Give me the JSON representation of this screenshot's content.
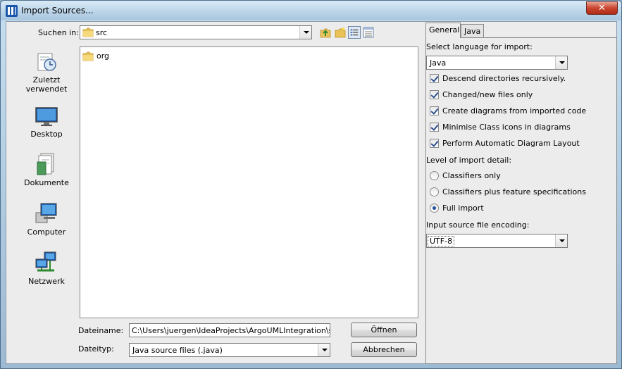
{
  "window": {
    "title": "Import Sources..."
  },
  "browser": {
    "look_in_label": "Suchen in:",
    "current_folder": "src",
    "places": [
      {
        "label_line1": "Zuletzt",
        "label_line2": "verwendet",
        "icon": "recent-icon"
      },
      {
        "label_line1": "Desktop",
        "label_line2": "",
        "icon": "desktop-icon"
      },
      {
        "label_line1": "Dokumente",
        "label_line2": "",
        "icon": "documents-icon"
      },
      {
        "label_line1": "Computer",
        "label_line2": "",
        "icon": "computer-icon"
      },
      {
        "label_line1": "Netzwerk",
        "label_line2": "",
        "icon": "network-icon"
      }
    ],
    "files": [
      {
        "name": "org",
        "icon": "folder-icon"
      }
    ],
    "filename_label": "Dateiname:",
    "filename_value": "C:\\Users\\juergen\\IdeaProjects\\ArgoUMLIntegration\\src",
    "filetype_label": "Dateityp:",
    "filetype_value": "Java source files (.java)",
    "open_button": "Öffnen",
    "cancel_button": "Abbrechen"
  },
  "options": {
    "tabs": [
      "General",
      "Java"
    ],
    "language_label": "Select language for import:",
    "language_value": "Java",
    "checkboxes": [
      {
        "label": "Descend directories recursively.",
        "checked": true
      },
      {
        "label": "Changed/new files only",
        "checked": true
      },
      {
        "label": "Create diagrams from imported code",
        "checked": true
      },
      {
        "label": "Minimise Class icons in diagrams",
        "checked": true
      },
      {
        "label": "Perform Automatic Diagram Layout",
        "checked": true
      }
    ],
    "detail_label": "Level of import detail:",
    "detail_options": [
      {
        "label": "Classifiers only",
        "selected": false
      },
      {
        "label": "Classifiers plus feature specifications",
        "selected": false
      },
      {
        "label": "Full import",
        "selected": true
      }
    ],
    "encoding_label": "Input source file encoding:",
    "encoding_value": "UTF-8"
  }
}
